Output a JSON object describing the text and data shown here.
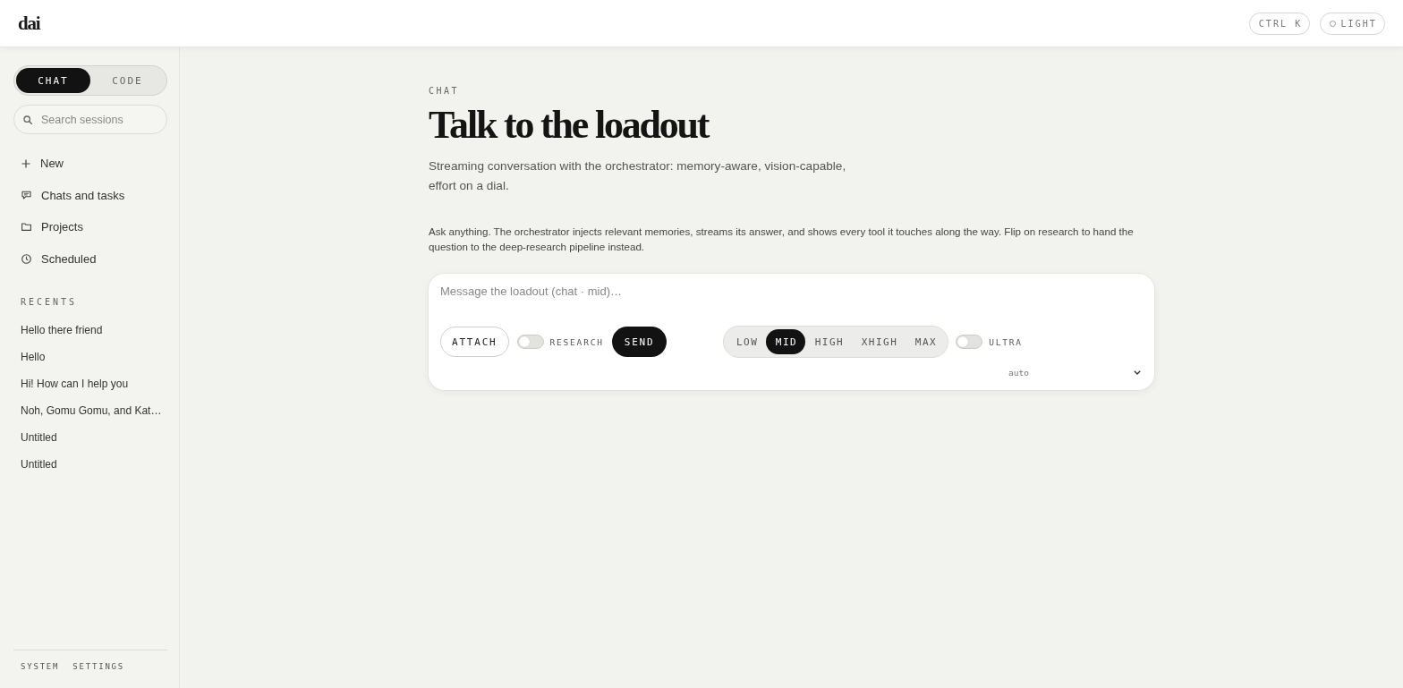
{
  "topbar": {
    "logo": "dai",
    "buttons": [
      {
        "kind": "shortcut",
        "label": "CTRL K"
      },
      {
        "kind": "theme",
        "label": "LIGHT"
      }
    ]
  },
  "sidebar": {
    "mode_tabs": [
      {
        "label": "CHAT",
        "selected": true
      },
      {
        "label": "CODE",
        "selected": false
      }
    ],
    "search": {
      "placeholder": "Search sessions"
    },
    "nav": [
      {
        "kind": "new",
        "label": "New"
      },
      {
        "kind": "chats",
        "label": "Chats and tasks"
      },
      {
        "kind": "projects",
        "label": "Projects"
      },
      {
        "kind": "scheduled",
        "label": "Scheduled"
      }
    ],
    "recents": {
      "title": "RECENTS",
      "items": [
        "Hello there friend",
        "Hello",
        "Hi! How can I help you",
        "Noh, Gomu Gomu, and Kat…",
        "Untitled",
        "Untitled"
      ]
    },
    "footer_links": [
      "SYSTEM",
      "SETTINGS"
    ]
  },
  "main": {
    "eyebrow": "CHAT",
    "title": "Talk to the loadout",
    "subtitle": "Streaming conversation with the orchestrator: memory-aware, vision-capable, effort on a dial.",
    "description": "Ask anything. The orchestrator injects relevant memories, streams its answer, and shows every tool it touches along the way. Flip on research to hand the question to the deep-research pipeline instead.",
    "composer": {
      "placeholder": "Message the loadout (chat · mid)…",
      "attach_label": "ATTACH",
      "research": {
        "label": "RESEARCH",
        "on": false
      },
      "send_label": "SEND",
      "effort": [
        {
          "label": "LOW",
          "selected": false
        },
        {
          "label": "MID",
          "selected": true
        },
        {
          "label": "HIGH",
          "selected": false
        },
        {
          "label": "XHIGH",
          "selected": false
        },
        {
          "label": "MAX",
          "selected": false
        }
      ],
      "ultra": {
        "label": "ULTRA",
        "on": false
      },
      "model": {
        "value": "auto"
      }
    }
  }
}
